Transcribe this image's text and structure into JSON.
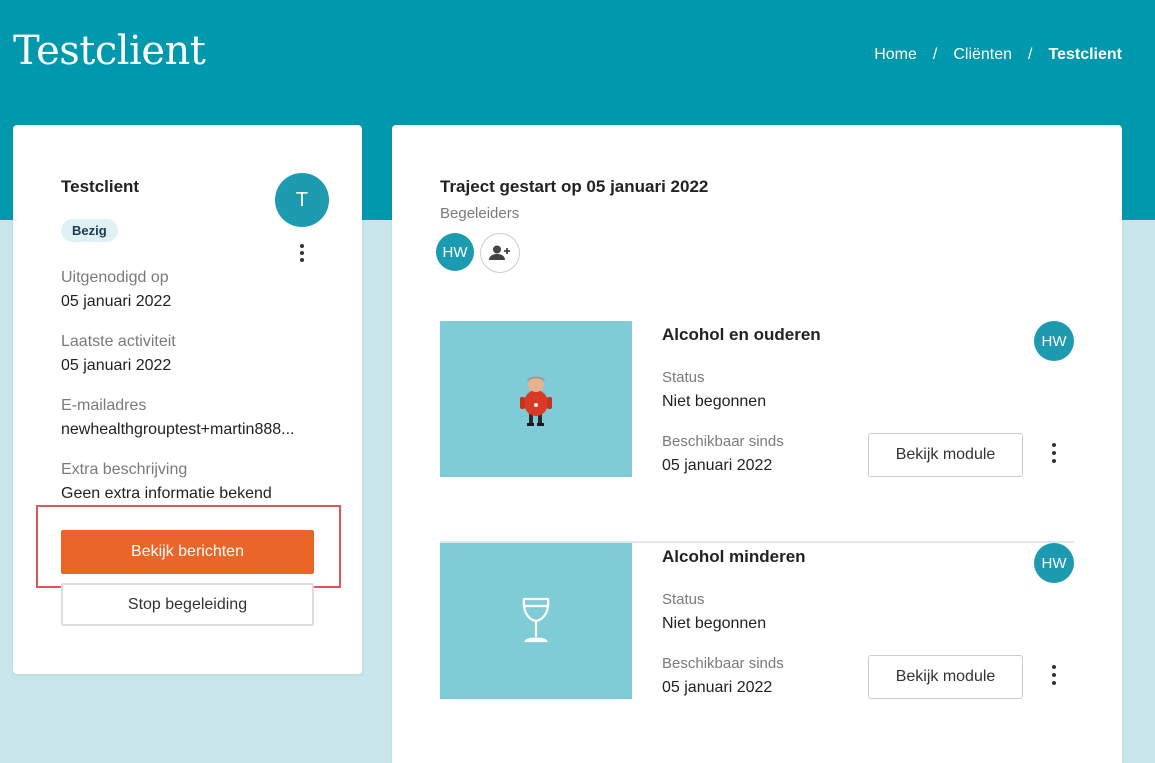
{
  "page": {
    "title": "Testclient"
  },
  "breadcrumb": {
    "home": "Home",
    "sep": "/",
    "clients": "Cliënten",
    "current": "Testclient"
  },
  "client": {
    "name": "Testclient",
    "avatar_initial": "T",
    "status": "Bezig",
    "fields": [
      {
        "label": "Uitgenodigd op",
        "value": "05 januari 2022"
      },
      {
        "label": "Laatste activiteit",
        "value": "05 januari 2022"
      },
      {
        "label": "E-mailadres",
        "value": "newhealthgrouptest+martin888..."
      },
      {
        "label": "Extra beschrijving",
        "value": "Geen extra informatie bekend"
      }
    ],
    "primary_button": "Bekijk berichten",
    "secondary_button": "Stop begeleiding"
  },
  "traject": {
    "title": "Traject gestart op 05 januari 2022",
    "begeleiders_label": "Begeleiders",
    "begeleider_initials": "HW"
  },
  "modules": [
    {
      "title": "Alcohol en ouderen",
      "status_label": "Status",
      "status_value": "Niet begonnen",
      "available_label": "Beschikbaar sinds",
      "available_value": "05 januari 2022",
      "avatar": "HW",
      "button": "Bekijk module",
      "thumbnail_icon": "elderly-man-illustration"
    },
    {
      "title": "Alcohol minderen",
      "status_label": "Status",
      "status_value": "Niet begonnen",
      "available_label": "Beschikbaar sinds",
      "available_value": "05 januari 2022",
      "avatar": "HW",
      "button": "Bekijk module",
      "thumbnail_icon": "wine-glass-icon"
    }
  ],
  "colors": {
    "header": "#0098ad",
    "background": "#c8e6ea",
    "accent": "#1c9bb0",
    "primary_button": "#ea6628",
    "thumbnail": "#80ccd6",
    "highlight": "#e05557"
  }
}
